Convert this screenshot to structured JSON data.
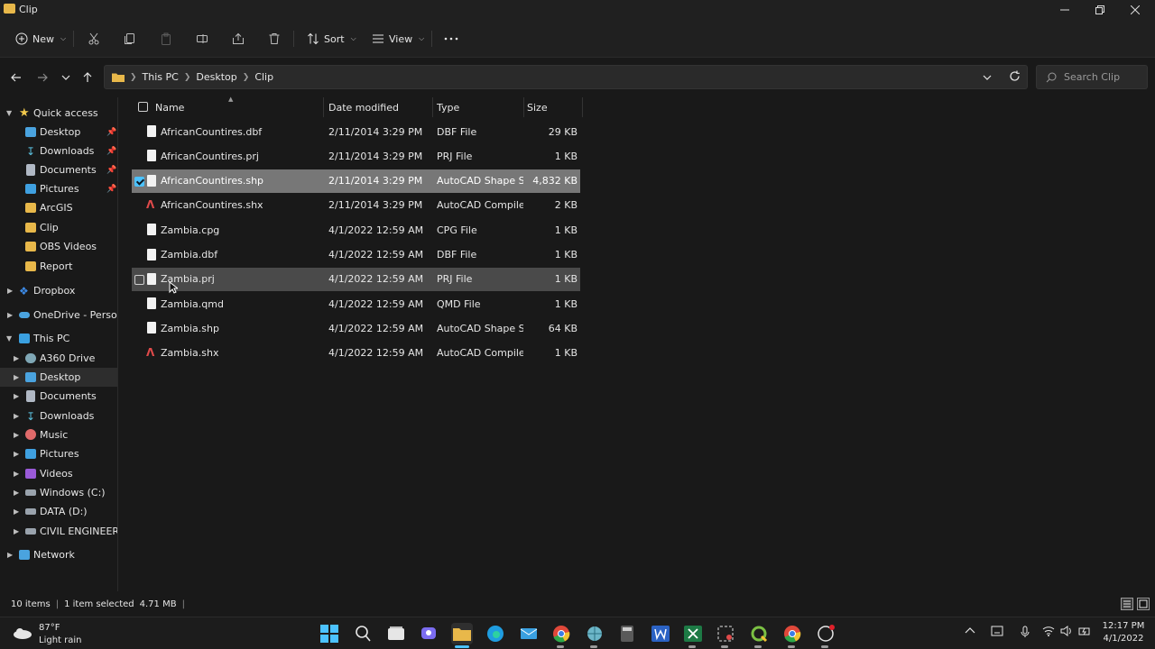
{
  "window": {
    "title": "Clip",
    "controls": [
      "minimize",
      "maximize",
      "close"
    ]
  },
  "toolbar": {
    "new_label": "New",
    "sort_label": "Sort",
    "view_label": "View"
  },
  "address": {
    "crumbs": [
      "This PC",
      "Desktop",
      "Clip"
    ]
  },
  "search": {
    "placeholder": "Search Clip"
  },
  "sidebar": {
    "quick_access": "Quick access",
    "pinned": [
      {
        "label": "Desktop",
        "icon": "desktop-icon",
        "pinned": true
      },
      {
        "label": "Downloads",
        "icon": "download-icon",
        "pinned": true
      },
      {
        "label": "Documents",
        "icon": "documents-icon",
        "pinned": true
      },
      {
        "label": "Pictures",
        "icon": "pictures-icon",
        "pinned": true
      },
      {
        "label": "ArcGIS",
        "icon": "folder-icon",
        "pinned": false
      },
      {
        "label": "Clip",
        "icon": "folder-icon",
        "pinned": false
      },
      {
        "label": "OBS Videos",
        "icon": "folder-icon",
        "pinned": false
      },
      {
        "label": "Report",
        "icon": "folder-icon",
        "pinned": false
      }
    ],
    "dropbox": "Dropbox",
    "onedrive": "OneDrive - Personal",
    "this_pc": "This PC",
    "pc_items": [
      {
        "label": "A360 Drive",
        "icon": "cloud-drive-icon"
      },
      {
        "label": "Desktop",
        "icon": "desktop-icon",
        "selected": true
      },
      {
        "label": "Documents",
        "icon": "documents-icon"
      },
      {
        "label": "Downloads",
        "icon": "download-icon"
      },
      {
        "label": "Music",
        "icon": "music-icon"
      },
      {
        "label": "Pictures",
        "icon": "pictures-icon"
      },
      {
        "label": "Videos",
        "icon": "videos-icon"
      },
      {
        "label": "Windows (C:)",
        "icon": "drive-icon"
      },
      {
        "label": "DATA (D:)",
        "icon": "drive-icon"
      },
      {
        "label": "CIVIL ENGINEERING",
        "icon": "drive-icon"
      }
    ],
    "network": "Network"
  },
  "columns": {
    "name": "Name",
    "date": "Date modified",
    "type": "Type",
    "size": "Size"
  },
  "files": [
    {
      "name": "AfricanCountires.dbf",
      "date": "2/11/2014 3:29 PM",
      "type": "DBF File",
      "size": "29 KB",
      "icon": "file-icon",
      "state": ""
    },
    {
      "name": "AfricanCountires.prj",
      "date": "2/11/2014 3:29 PM",
      "type": "PRJ File",
      "size": "1 KB",
      "icon": "file-icon",
      "state": ""
    },
    {
      "name": "AfricanCountires.shp",
      "date": "2/11/2014 3:29 PM",
      "type": "AutoCAD Shape S...",
      "size": "4,832 KB",
      "icon": "file-icon",
      "state": "selected"
    },
    {
      "name": "AfricanCountires.shx",
      "date": "2/11/2014 3:29 PM",
      "type": "AutoCAD Compile...",
      "size": "2 KB",
      "icon": "autocad-icon",
      "state": ""
    },
    {
      "name": "Zambia.cpg",
      "date": "4/1/2022 12:59 AM",
      "type": "CPG File",
      "size": "1 KB",
      "icon": "file-icon",
      "state": ""
    },
    {
      "name": "Zambia.dbf",
      "date": "4/1/2022 12:59 AM",
      "type": "DBF File",
      "size": "1 KB",
      "icon": "file-icon",
      "state": ""
    },
    {
      "name": "Zambia.prj",
      "date": "4/1/2022 12:59 AM",
      "type": "PRJ File",
      "size": "1 KB",
      "icon": "file-icon",
      "state": "hover"
    },
    {
      "name": "Zambia.qmd",
      "date": "4/1/2022 12:59 AM",
      "type": "QMD File",
      "size": "1 KB",
      "icon": "file-icon",
      "state": ""
    },
    {
      "name": "Zambia.shp",
      "date": "4/1/2022 12:59 AM",
      "type": "AutoCAD Shape S...",
      "size": "64 KB",
      "icon": "file-icon",
      "state": ""
    },
    {
      "name": "Zambia.shx",
      "date": "4/1/2022 12:59 AM",
      "type": "AutoCAD Compile...",
      "size": "1 KB",
      "icon": "autocad-icon",
      "state": ""
    }
  ],
  "status": {
    "items": "10 items",
    "selected": "1 item selected",
    "size": "4.71 MB"
  },
  "weather": {
    "temp": "87°F",
    "desc": "Light rain"
  },
  "clock": {
    "time": "12:17 PM",
    "date": "4/1/2022"
  },
  "colors": {
    "selection": "#777777",
    "hover": "#4a4a4a",
    "accent": "#4cc2ff",
    "folder": "#e8b84a"
  }
}
